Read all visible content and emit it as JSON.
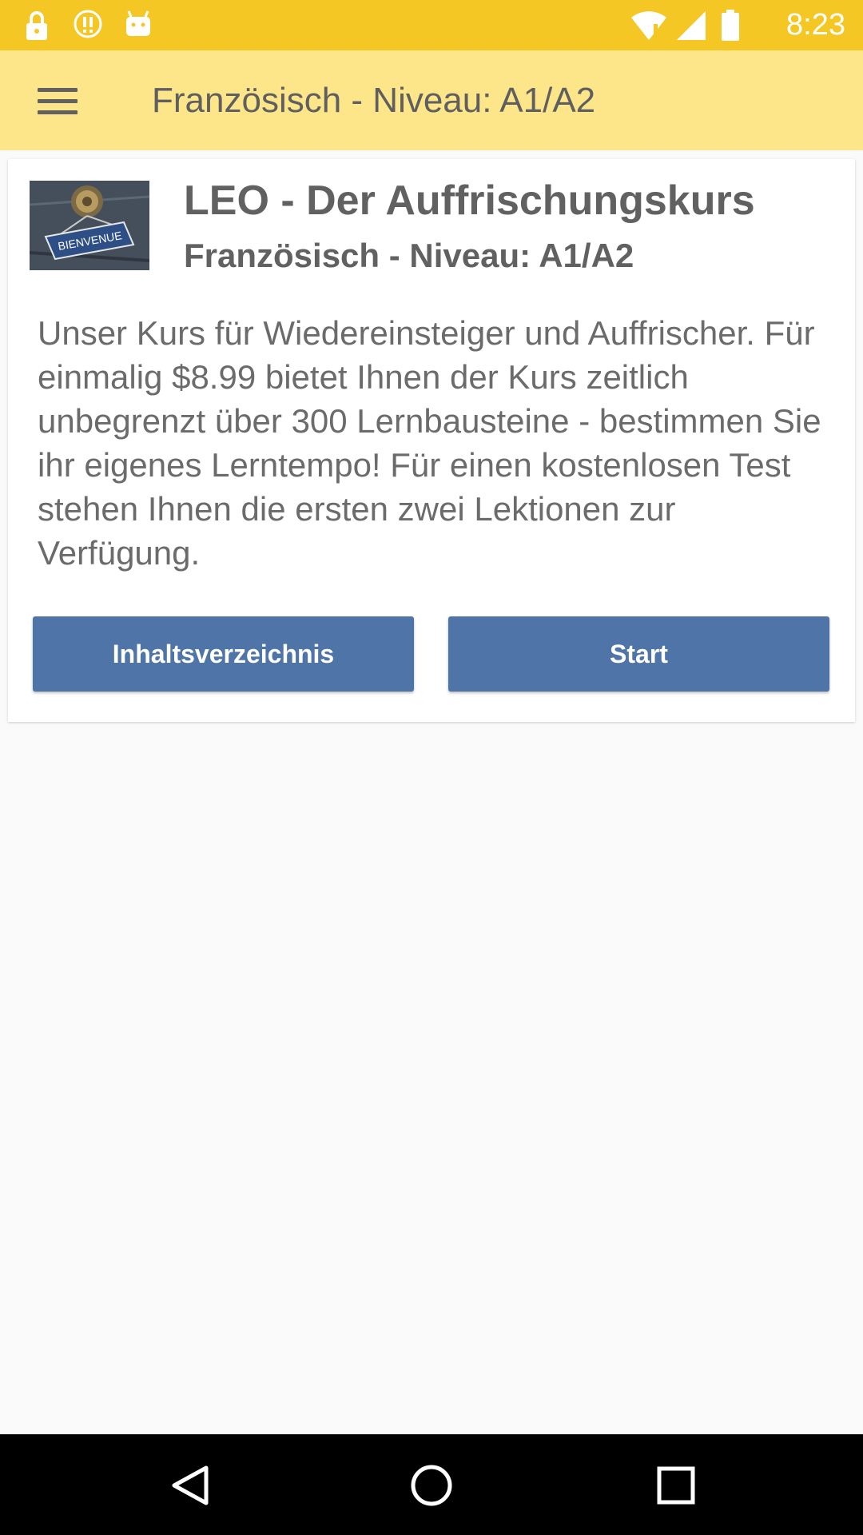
{
  "status_bar": {
    "time": "8:23",
    "icons": [
      "lock-icon",
      "alert-icon",
      "android-icon",
      "wifi-icon",
      "signal-icon",
      "battery-icon"
    ]
  },
  "app_bar": {
    "menu_icon": "hamburger-menu-icon",
    "title": "Französisch - Niveau: A1/A2"
  },
  "course": {
    "image_icon": "bienvenue-sign-image",
    "image_caption": "BIENVENUE",
    "title": "LEO - Der Auffrischungskurs",
    "subtitle": "Französisch - Niveau: A1/A2",
    "description": "Unser Kurs für Wiedereinsteiger und Auffrischer. Für einmalig $8.99 bietet Ihnen der Kurs zeitlich unbegrenzt über 300 Lernbausteine - bestimmen Sie ihr eigenes Lerntempo! Für einen kostenlosen Test stehen Ihnen die ersten zwei Lektionen zur Verfügung.",
    "buttons": {
      "toc_label": "Inhaltsverzeichnis",
      "start_label": "Start"
    }
  },
  "nav_bar": {
    "icons": [
      "back-icon",
      "home-icon",
      "recents-icon"
    ]
  },
  "colors": {
    "status_bar": "#f5c724",
    "app_bar": "#fde68a",
    "button": "#4f74a8"
  }
}
